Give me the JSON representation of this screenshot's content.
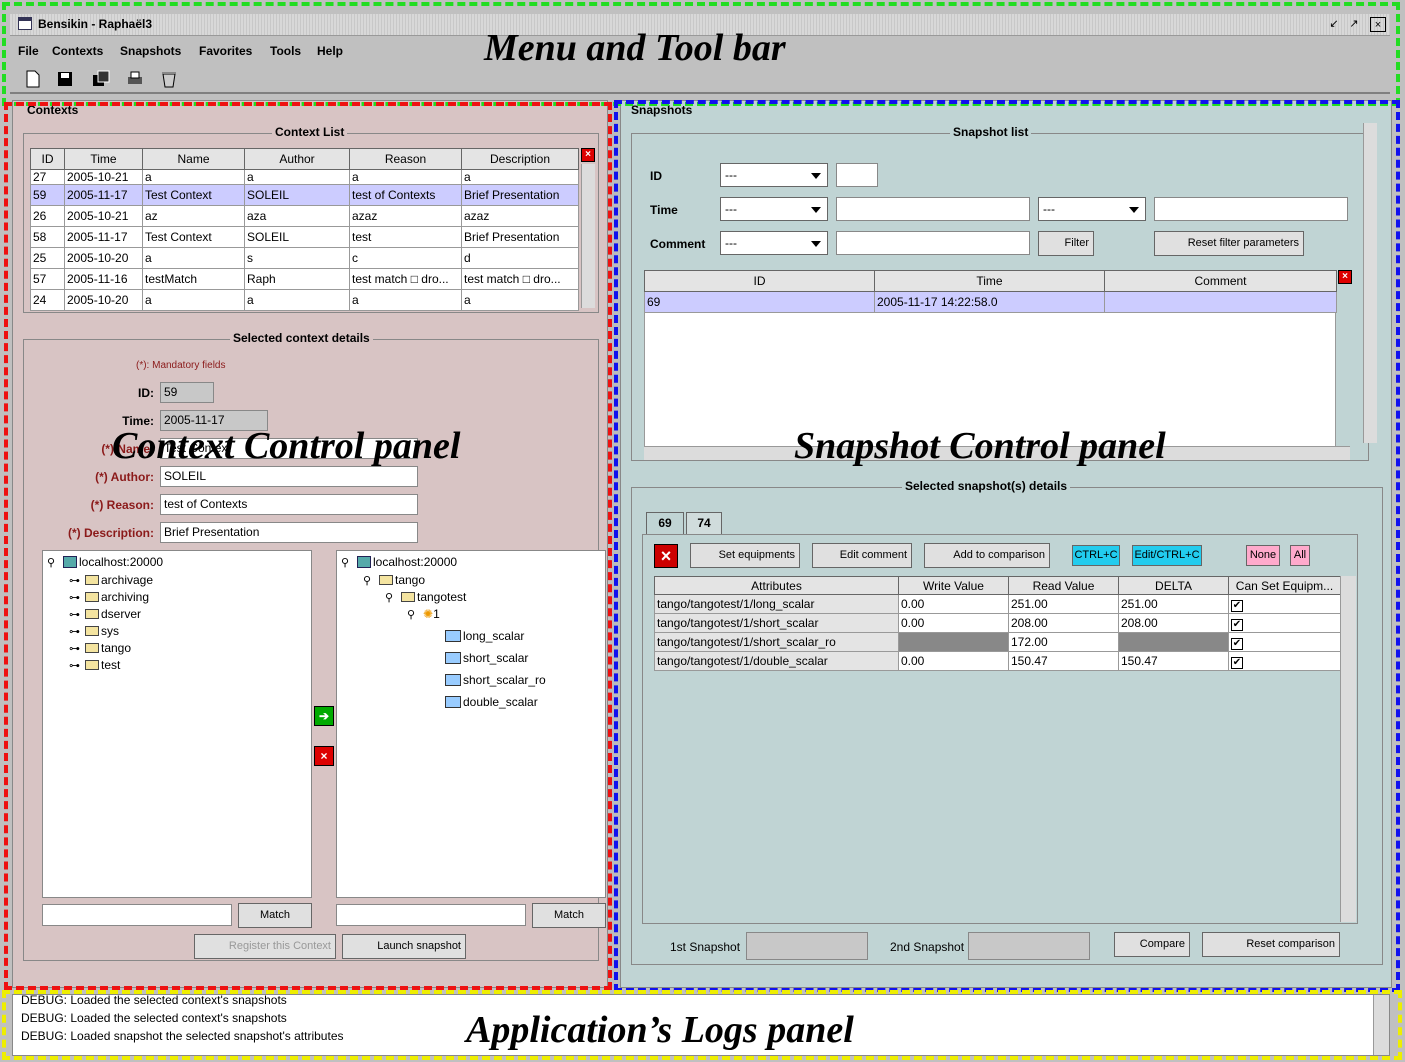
{
  "window": {
    "title": "Bensikin - Raphaël3"
  },
  "menu": [
    "File",
    "Contexts",
    "Snapshots",
    "Favorites",
    "Tools",
    "Help"
  ],
  "captions": {
    "menu_toolbar": "Menu and Tool bar",
    "context_panel": "Context Control panel",
    "snapshot_panel": "Snapshot Control panel",
    "logs_panel": "Application’s Logs panel"
  },
  "contexts": {
    "title": "Contexts",
    "list_title": "Context List",
    "columns": [
      "ID",
      "Time",
      "Name",
      "Author",
      "Reason",
      "Description"
    ],
    "rows": [
      [
        "27",
        "2005-10-21",
        "a",
        "a",
        "a",
        "a"
      ],
      [
        "59",
        "2005-11-17",
        "Test Context",
        "SOLEIL",
        "test of Contexts",
        "Brief Presentation"
      ],
      [
        "26",
        "2005-10-21",
        "az",
        "aza",
        "azaz",
        "azaz"
      ],
      [
        "58",
        "2005-11-17",
        "Test Context",
        "SOLEIL",
        "test",
        "Brief Presentation"
      ],
      [
        "25",
        "2005-10-20",
        "a",
        "s",
        "c",
        "d"
      ],
      [
        "57",
        "2005-11-16",
        "testMatch",
        "Raph",
        "test match □ dro...",
        "test match □ dro..."
      ],
      [
        "24",
        "2005-10-20",
        "a",
        "a",
        "a",
        "a"
      ]
    ],
    "details_title": "Selected context details",
    "mandatory_note": "(*): Mandatory fields",
    "id_label": "ID:",
    "id_value": "59",
    "time_label": "Time:",
    "time_value": "2005-11-17",
    "name_label": "(*) Name:",
    "name_value": "Test Context",
    "author_label": "(*) Author:",
    "author_value": "SOLEIL",
    "reason_label": "(*) Reason:",
    "reason_value": "test of Contexts",
    "description_label": "(*) Description:",
    "description_value": "Brief Presentation",
    "left_tree": {
      "root": "localhost:20000",
      "children": [
        "archivage",
        "archiving",
        "dserver",
        "sys",
        "tango",
        "test"
      ]
    },
    "right_tree": {
      "root": "localhost:20000",
      "l1": "tango",
      "l2": "tangotest",
      "l3": "1",
      "attrs": [
        "long_scalar",
        "short_scalar",
        "short_scalar_ro",
        "double_scalar"
      ]
    },
    "match_label": "Match",
    "register_label": "Register this Context",
    "launch_label": "Launch snapshot"
  },
  "snapshots": {
    "title": "Snapshots",
    "list_title": "Snapshot list",
    "id_label": "ID",
    "time_label": "Time",
    "comment_label": "Comment",
    "combo_value": "---",
    "filter_label": "Filter",
    "reset_filter_label": "Reset filter parameters",
    "columns": [
      "ID",
      "Time",
      "Comment"
    ],
    "rows": [
      [
        "69",
        "2005-11-17 14:22:58.0",
        ""
      ]
    ],
    "details_title": "Selected snapshot(s) details",
    "tabs": [
      "69",
      "74"
    ],
    "set_equipments": "Set equipments",
    "edit_comment": "Edit comment",
    "add_comparison": "Add to comparison",
    "ctrl_c": "CTRL+C",
    "edit_ctrl_c": "Edit/CTRL+C",
    "none": "None",
    "all": "All",
    "attr_columns": [
      "Attributes",
      "Write Value",
      "Read Value",
      "DELTA",
      "Can Set Equipm..."
    ],
    "attr_rows": [
      [
        "tango/tangotest/1/long_scalar",
        "0.00",
        "251.00",
        "251.00"
      ],
      [
        "tango/tangotest/1/short_scalar",
        "0.00",
        "208.00",
        "208.00"
      ],
      [
        "tango/tangotest/1/short_scalar_ro",
        "",
        "172.00",
        ""
      ],
      [
        "tango/tangotest/1/double_scalar",
        "0.00",
        "150.47",
        "150.47"
      ]
    ],
    "first_snapshot": "1st Snapshot",
    "second_snapshot": "2nd Snapshot",
    "compare_label": "Compare",
    "reset_comparison_label": "Reset comparison"
  },
  "logs": [
    "DEBUG: Loaded the selected context's snapshots",
    "DEBUG: Loaded the selected context's snapshots",
    "DEBUG: Loaded snapshot the selected snapshot's attributes"
  ],
  "colors": {
    "context_bg": "#d8c4c4",
    "snapshot_bg": "#c0d4d4",
    "selection": "#ccccff"
  }
}
